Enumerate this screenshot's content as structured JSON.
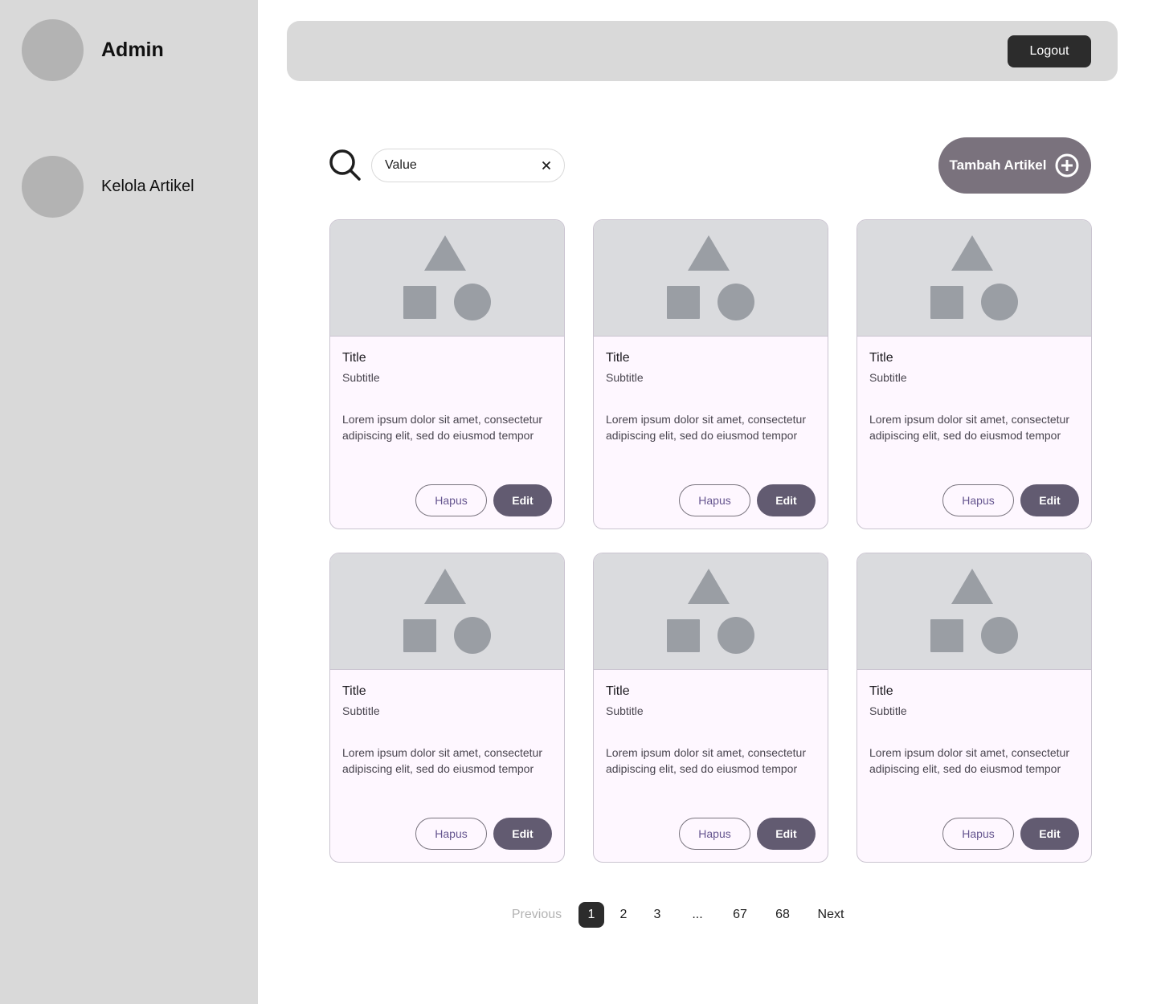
{
  "sidebar": {
    "user_name": "Admin",
    "nav_item": "Kelola Artikel"
  },
  "header": {
    "logout_label": "Logout"
  },
  "search": {
    "value": "Value"
  },
  "add_button_label": "Tambah Artikel",
  "cards": [
    {
      "title": "Title",
      "subtitle": "Subtitle",
      "body": "Lorem ipsum dolor sit amet, consectetur adipiscing elit, sed do eiusmod tempor",
      "delete_label": "Hapus",
      "edit_label": "Edit"
    },
    {
      "title": "Title",
      "subtitle": "Subtitle",
      "body": "Lorem ipsum dolor sit amet, consectetur adipiscing elit, sed do eiusmod tempor",
      "delete_label": "Hapus",
      "edit_label": "Edit"
    },
    {
      "title": "Title",
      "subtitle": "Subtitle",
      "body": "Lorem ipsum dolor sit amet, consectetur adipiscing elit, sed do eiusmod tempor",
      "delete_label": "Hapus",
      "edit_label": "Edit"
    },
    {
      "title": "Title",
      "subtitle": "Subtitle",
      "body": "Lorem ipsum dolor sit amet, consectetur adipiscing elit, sed do eiusmod tempor",
      "delete_label": "Hapus",
      "edit_label": "Edit"
    },
    {
      "title": "Title",
      "subtitle": "Subtitle",
      "body": "Lorem ipsum dolor sit amet, consectetur adipiscing elit, sed do eiusmod tempor",
      "delete_label": "Hapus",
      "edit_label": "Edit"
    },
    {
      "title": "Title",
      "subtitle": "Subtitle",
      "body": "Lorem ipsum dolor sit amet, consectetur adipiscing elit, sed do eiusmod tempor",
      "delete_label": "Hapus",
      "edit_label": "Edit"
    }
  ],
  "pagination": {
    "previous_label": "Previous",
    "pages": [
      "1",
      "2",
      "3",
      "...",
      "67",
      "68"
    ],
    "current_page": "1",
    "next_label": "Next"
  }
}
